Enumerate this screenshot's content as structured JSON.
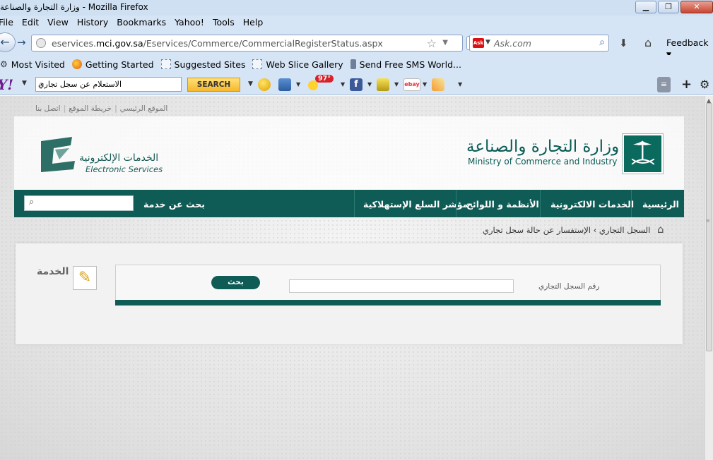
{
  "window": {
    "title": "وزارة التجارة والصناعة - Mozilla Firefox",
    "buttons": {
      "minimize": "▁",
      "maximize": "❐",
      "close": "✕"
    }
  },
  "menubar": {
    "items": [
      "File",
      "Edit",
      "View",
      "History",
      "Bookmarks",
      "Yahoo!",
      "Tools",
      "Help"
    ]
  },
  "navbar": {
    "url_prefix": "eservices.",
    "url_domain": "mci.gov.sa",
    "url_path": "/Eservices/Commerce/CommercialRegisterStatus.aspx",
    "search_placeholder": "Ask.com",
    "search_engine_icon": "Ask",
    "feedback_label": "Feedback"
  },
  "bookmarks": {
    "items": [
      {
        "label": "Most Visited",
        "icon": "gear-icon"
      },
      {
        "label": "Getting Started",
        "icon": "firefox-icon"
      },
      {
        "label": "Suggested Sites",
        "icon": "page-icon"
      },
      {
        "label": "Web Slice Gallery",
        "icon": "page-icon"
      },
      {
        "label": "Send Free SMS World...",
        "icon": "phone-icon"
      }
    ]
  },
  "yahoo_toolbar": {
    "logo": "Y!",
    "search_value": "الاستعلام عن سجل تجاري",
    "search_button": "SEARCH",
    "weather_badge": "97°",
    "facebook_label": "f",
    "ebay_label": "ebay"
  },
  "site": {
    "top_links": [
      "الموقع الرئيسي",
      "خريطة الموقع",
      "اتصل بنا"
    ],
    "eservices_logo_ar": "الخدمات الإلكترونية",
    "eservices_logo_en": "Electronic Services",
    "ministry_ar": "وزارة التجارة والصناعة",
    "ministry_en": "Ministry of Commerce and Industry",
    "nav": {
      "home": "الرئيسية",
      "eservices": "الخدمات الالكترونية",
      "regulations": "الأنظمة و اللوائح",
      "consumer_index": "مؤشر السلع الإستهلاكية",
      "search_label": "بحث عن خدمة"
    },
    "breadcrumb": {
      "root": "السجل التجاري",
      "current": "الإستفسار عن حالة سجل تجاري",
      "separator": "›"
    },
    "rate_service": "قيم الخدمة",
    "form": {
      "cr_label": "رقم السجل التجاري",
      "cr_value": "",
      "search_button": "بحث"
    }
  },
  "colors": {
    "brand_green": "#0f5c56",
    "chrome_blue": "#d6e5f5",
    "yahoo_button": "#f7b82a"
  }
}
